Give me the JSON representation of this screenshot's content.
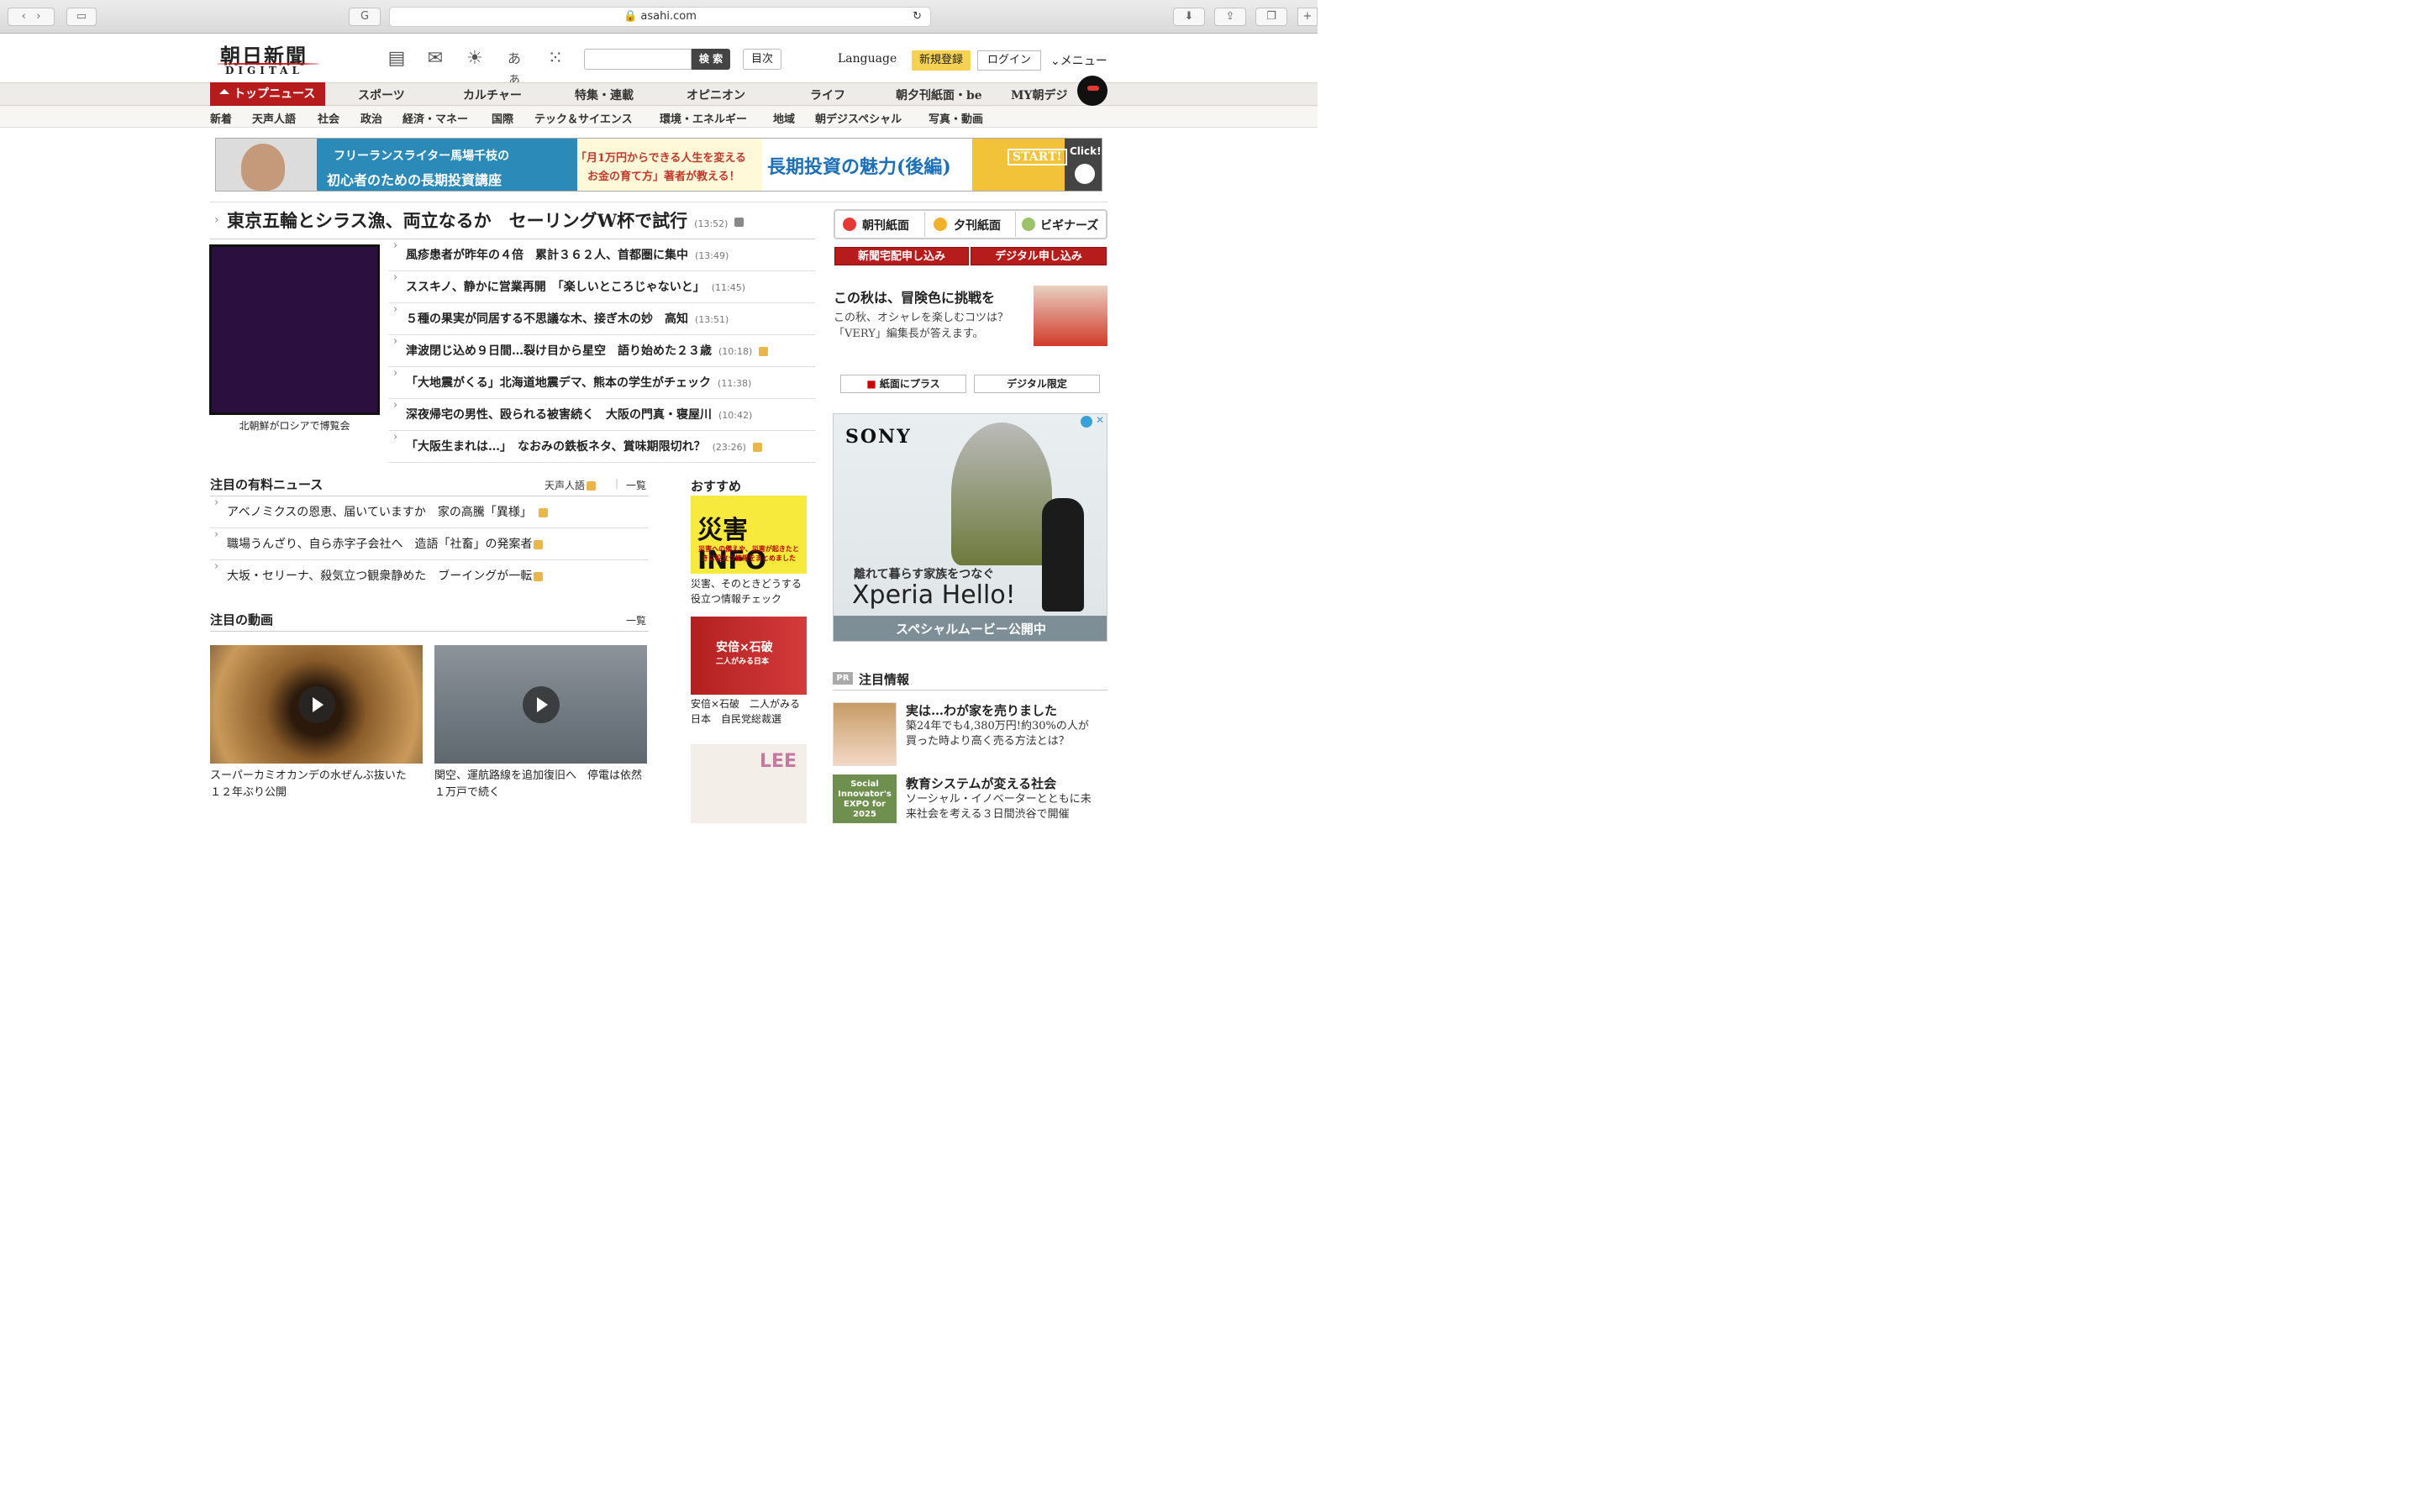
{
  "browser": {
    "url": "asahi.com",
    "tabs_add": "+"
  },
  "logo": {
    "main": "朝日新聞",
    "sub": "DIGITAL"
  },
  "header": {
    "search_button": "検 索",
    "toc_button": "目次",
    "language": "Language",
    "register": "新規登録",
    "login": "ログイン",
    "menu": "メニュー",
    "icons": [
      "newspaper-icon",
      "mail-icon",
      "weather-icon",
      "font-size-icon",
      "apps-grid-icon"
    ],
    "font_icon_text": "あぁ"
  },
  "nav_primary": [
    "トップニュース",
    "スポーツ",
    "カルチャー",
    "特集・連載",
    "オピニオン",
    "ライフ",
    "朝夕刊紙面・be",
    "MY朝デジ"
  ],
  "nav_secondary": [
    "新着",
    "天声人語",
    "社会",
    "政治",
    "経済・マネー",
    "国際",
    "テック＆サイエンス",
    "環境・エネルギー",
    "地域",
    "朝デジスペシャル",
    "写真・動画"
  ],
  "banner": {
    "line1": "フリーランスライター馬場千枝の",
    "line2": "初心者のための長期投資講座",
    "line3": "「月1万円からできる人生を変える",
    "line4": "お金の育て方」著者が教える！",
    "line5": "長期投資の魅力(後編)",
    "start": "START!",
    "click": "Click!"
  },
  "top_headline": {
    "title": "東京五輪とシラス漁、両立なるか　セーリングW杯で試行",
    "time": "(13:52)"
  },
  "photo_caption": "北朝鮮がロシアで博覧会",
  "news": [
    {
      "title": "風疹患者が昨年の４倍　累計３６２人、首都圏に集中",
      "time": "(13:49)",
      "locked": false
    },
    {
      "title": "ススキノ、静かに営業再開　「楽しいところじゃないと」",
      "time": "(11:45)",
      "locked": false
    },
    {
      "title": "５種の果実が同居する不思議な木、接ぎ木の妙　高知",
      "time": "(13:51)",
      "locked": false
    },
    {
      "title": "津波閉じ込め９日間…裂け目から星空　語り始めた２３歳",
      "time": "(10:18)",
      "locked": true
    },
    {
      "title": "「大地震がくる」北海道地震デマ、熊本の学生がチェック",
      "time": "(11:38)",
      "locked": false
    },
    {
      "title": "深夜帰宅の男性、殴られる被害続く　大阪の門真・寝屋川",
      "time": "(10:42)",
      "locked": false
    },
    {
      "title": "「大阪生まれは…」　なおみの鉄板ネタ、賞味期限切れ？",
      "time": "(23:26)",
      "locked": true
    }
  ],
  "paid_news": {
    "title": "注目の有料ニュース",
    "link1": "天声人語",
    "link2": "一覧",
    "items": [
      "アベノミクスの恩恵、届いていますか　家の高騰「異様」",
      "職場うんざり、自ら赤字子会社へ　造語「社畜」の発案者",
      "大坂・セリーナ、殺気立つ観衆静めた　ブーイングが一転"
    ]
  },
  "videos": {
    "title": "注目の動画",
    "link": "一覧",
    "items": [
      {
        "caption": "スーパーカミオカンデの水ぜんぶ抜いた　１２年ぶり公開"
      },
      {
        "caption": "関空、運航路線を追加復旧へ　停電は依然１万戸で続く"
      }
    ]
  },
  "recommended": {
    "title": "おすすめ",
    "items": [
      {
        "image_text": "災害INFO",
        "image_sub": "災害への備えや、災害が起きたときに役立つ情報をまとめました",
        "caption": "災害、そのときどうする 役立つ情報チェック"
      },
      {
        "image_text": "安倍×石破",
        "image_sub": "二人がみる日本",
        "caption": "安倍×石破　二人がみる日本　自民党総裁選"
      },
      {
        "image_text": "LEE",
        "caption": ""
      }
    ]
  },
  "paper_tabs": [
    "朝刊紙面",
    "夕刊紙面",
    "ビギナーズ"
  ],
  "subscribe": {
    "home": "新聞宅配申し込み",
    "digital": "デジタル申し込み"
  },
  "promo": {
    "title": "この秋は、冒険色に挑戦を",
    "text": "この秋、オシャレを楽しむコツは？　「VERY」編集長が答えます。",
    "btn1": "紙面にプラス",
    "btn2": "デジタル限定"
  },
  "ad": {
    "brand": "SONY",
    "line1": "離れて暮らす家族をつなぐ",
    "line2": "Xperia Hello!",
    "bar": "スペシャルムービー公開中"
  },
  "pr": {
    "badge": "PR",
    "title": "注目情報",
    "items": [
      {
        "title": "実は…わが家を売りました",
        "text": "築24年でも4,380万円!約30%の人が買った時より高く売る方法とは？"
      },
      {
        "title": "教育システムが変える社会",
        "text": "ソーシャル・イノベーターとともに未来社会を考える３日間渋谷で開催",
        "image_text": "Social Innovator's EXPO for 2025"
      }
    ]
  },
  "colors": {
    "brand_red": "#b71c1c",
    "lock_gold": "#e8b64a",
    "register_yellow": "#f5d252"
  }
}
